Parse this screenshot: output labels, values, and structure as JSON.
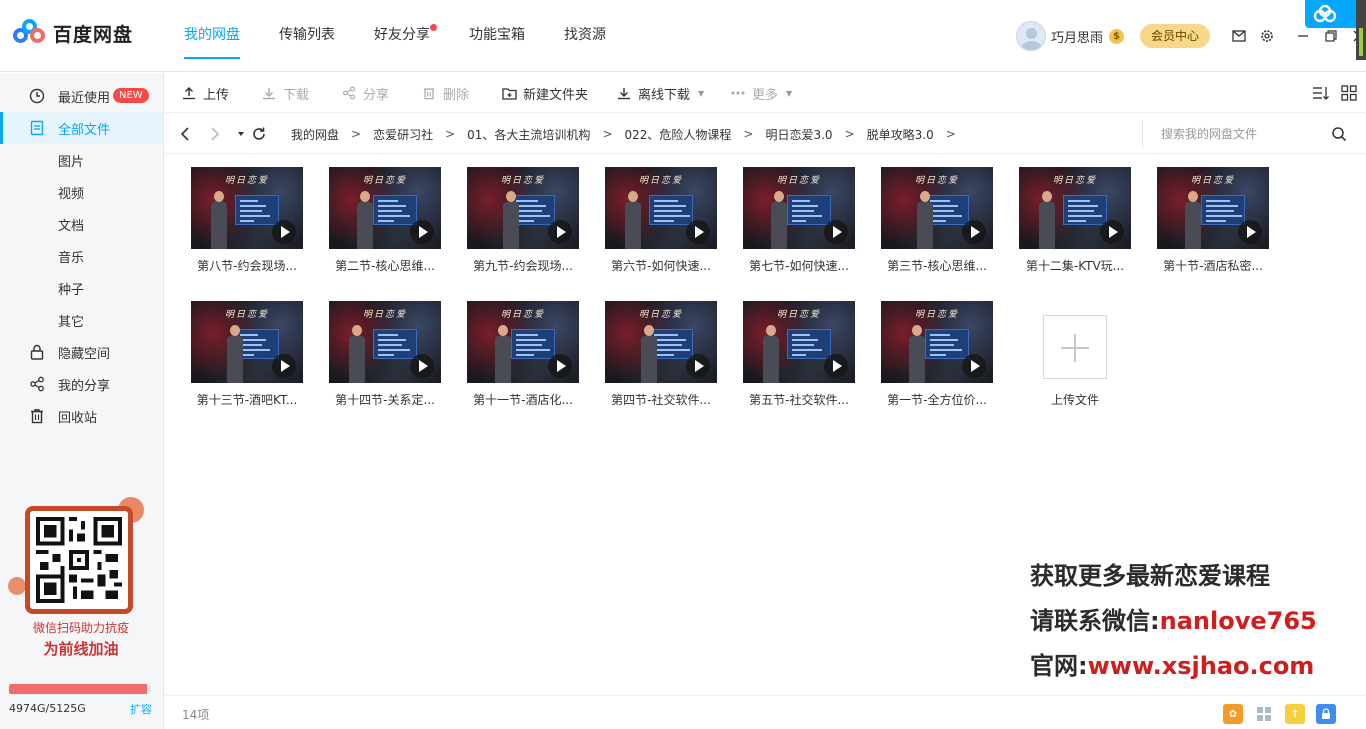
{
  "app": {
    "name": "百度网盘",
    "colors": {
      "accent": "#06a7ff",
      "danger": "#f5484a",
      "vip": "#f7d888"
    }
  },
  "nav": {
    "tabs": [
      {
        "label": "我的网盘",
        "active": true
      },
      {
        "label": "传输列表"
      },
      {
        "label": "好友分享",
        "dot": true
      },
      {
        "label": "功能宝箱"
      },
      {
        "label": "找资源"
      }
    ]
  },
  "user": {
    "name": "巧月思雨",
    "vip_badge": "$",
    "member_button": "会员中心"
  },
  "window_icons": [
    "mail-icon",
    "settings-icon",
    "minimize-icon",
    "restore-icon",
    "close-icon"
  ],
  "sidebar": {
    "items": [
      {
        "label": "最近使用",
        "icon": "clock-icon",
        "badge": "NEW"
      },
      {
        "label": "全部文件",
        "icon": "document-icon",
        "active": true
      },
      {
        "label": "图片"
      },
      {
        "label": "视频"
      },
      {
        "label": "文档"
      },
      {
        "label": "音乐"
      },
      {
        "label": "种子"
      },
      {
        "label": "其它"
      },
      {
        "label": "隐藏空间",
        "icon": "lock-icon"
      },
      {
        "label": "我的分享",
        "icon": "share-icon"
      },
      {
        "label": "回收站",
        "icon": "trash-icon"
      }
    ],
    "promo": {
      "line1": "微信扫码助力抗疫",
      "line2": "为前线加油"
    },
    "quota": {
      "text": "4974G/5125G",
      "used_fraction": 0.9705,
      "expand": "扩容"
    }
  },
  "toolbar": {
    "upload": "上传",
    "download": "下载",
    "share": "分享",
    "delete": "删除",
    "new_folder": "新建文件夹",
    "offline_download": "离线下载",
    "more": "更多"
  },
  "path": {
    "crumbs": [
      "我的网盘",
      "恋爱研习社",
      "01、各大主流培训机构",
      "022、危险人物课程",
      "明日恋爱3.0",
      "脱单攻略3.0"
    ]
  },
  "search": {
    "placeholder": "搜索我的网盘文件"
  },
  "files": [
    {
      "name": "第八节-约会现场..."
    },
    {
      "name": "第二节-核心思维..."
    },
    {
      "name": "第九节-约会现场..."
    },
    {
      "name": "第六节-如何快速..."
    },
    {
      "name": "第七节-如何快速..."
    },
    {
      "name": "第三节-核心思维..."
    },
    {
      "name": "第十二集-KTV玩..."
    },
    {
      "name": "第十节-酒店私密..."
    },
    {
      "name": "第十三节-酒吧KT..."
    },
    {
      "name": "第十四节-关系定..."
    },
    {
      "name": "第十一节-酒店化..."
    },
    {
      "name": "第四节-社交软件..."
    },
    {
      "name": "第五节-社交软件..."
    },
    {
      "name": "第一节-全方位价..."
    }
  ],
  "thumb_banner": "明日恋爱",
  "upload_tile": {
    "label": "上传文件"
  },
  "watermark": {
    "line1": "获取更多最新恋爱课程",
    "line2_prefix": "请联系微信:",
    "line2_value": "nanlove765",
    "line3_prefix": "官网:",
    "line3_value": "www.xsjhao.com"
  },
  "status": {
    "count": "14项"
  }
}
